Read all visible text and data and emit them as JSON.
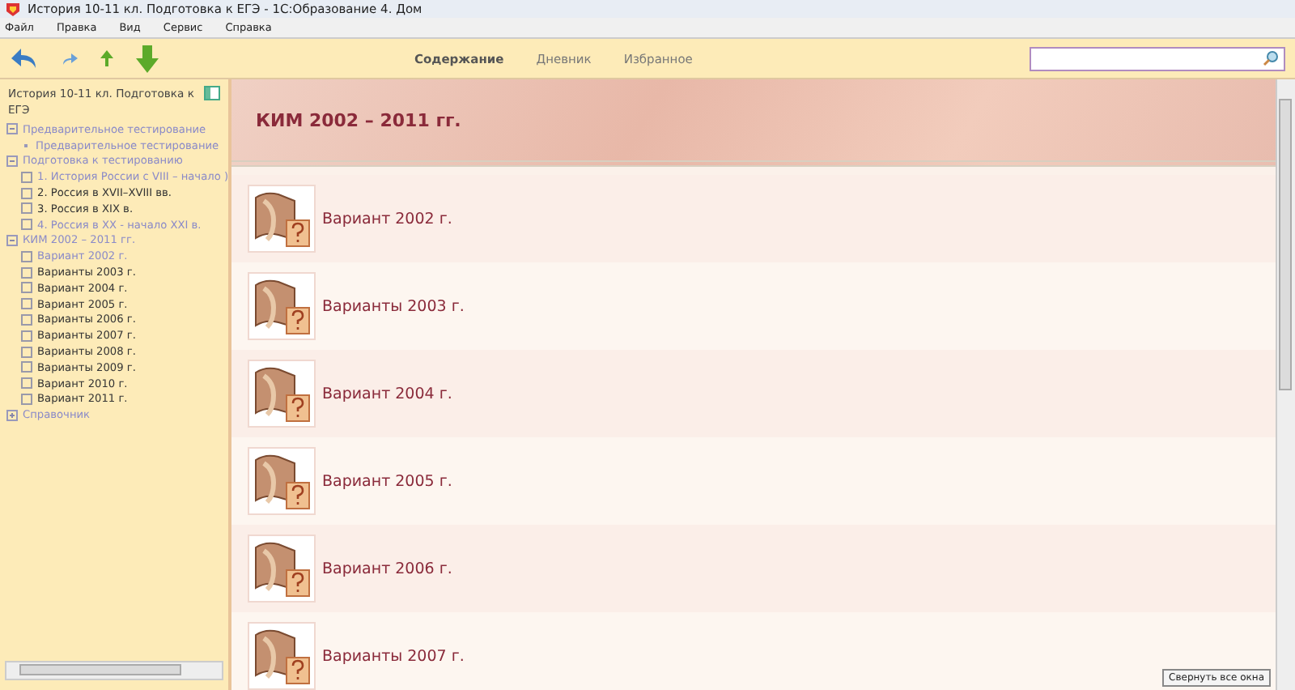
{
  "window": {
    "title": "История 10-11 кл. Подготовка к ЕГЭ - 1С:Образование 4. Дом"
  },
  "menu": [
    "Файл",
    "Правка",
    "Вид",
    "Сервис",
    "Справка"
  ],
  "tabs": [
    {
      "label": "Содержание",
      "selected": true
    },
    {
      "label": "Дневник",
      "selected": false
    },
    {
      "label": "Избранное",
      "selected": false
    }
  ],
  "sidebar": {
    "title": "История 10-11 кл. Подготовка к ЕГЭ",
    "items": [
      {
        "label": "Предварительное тестирование",
        "expanded": true,
        "visited": true,
        "children": [
          {
            "label": "Предварительное тестирование",
            "kind": "dot",
            "visited": true
          }
        ]
      },
      {
        "label": "Подготовка к тестированию",
        "expanded": true,
        "visited": true,
        "children": [
          {
            "label": "1. История России с VIII – начало )",
            "kind": "box",
            "visited": true
          },
          {
            "label": "2. Россия в XVII–XVIII вв.",
            "kind": "box",
            "visited": false
          },
          {
            "label": "3. Россия в XIX в.",
            "kind": "box",
            "visited": false
          },
          {
            "label": "4. Россия в XX - начало XXI в.",
            "kind": "box",
            "visited": true
          }
        ]
      },
      {
        "label": "КИМ 2002 – 2011 гг.",
        "expanded": true,
        "visited": true,
        "children": [
          {
            "label": "Вариант 2002 г.",
            "kind": "box",
            "visited": true
          },
          {
            "label": "Варианты 2003 г.",
            "kind": "box",
            "visited": false
          },
          {
            "label": "Вариант 2004 г.",
            "kind": "box",
            "visited": false
          },
          {
            "label": "Вариант 2005 г.",
            "kind": "box",
            "visited": false
          },
          {
            "label": "Варианты 2006 г.",
            "kind": "box",
            "visited": false
          },
          {
            "label": "Варианты 2007 г.",
            "kind": "box",
            "visited": false
          },
          {
            "label": "Варианты 2008 г.",
            "kind": "box",
            "visited": false
          },
          {
            "label": "Варианты 2009 г.",
            "kind": "box",
            "visited": false
          },
          {
            "label": "Вариант 2010 г.",
            "kind": "box",
            "visited": false
          },
          {
            "label": "Вариант 2011 г.",
            "kind": "box",
            "visited": false
          }
        ]
      },
      {
        "label": "Справочник",
        "expanded": false,
        "visited": true
      }
    ]
  },
  "content": {
    "heading": "КИМ 2002 – 2011 гг.",
    "rows": [
      "Вариант 2002 г.",
      "Варианты 2003 г.",
      "Вариант 2004 г.",
      "Вариант 2005 г.",
      "Вариант 2006 г.",
      "Варианты 2007 г."
    ]
  },
  "tooltip": "Свернуть все окна"
}
